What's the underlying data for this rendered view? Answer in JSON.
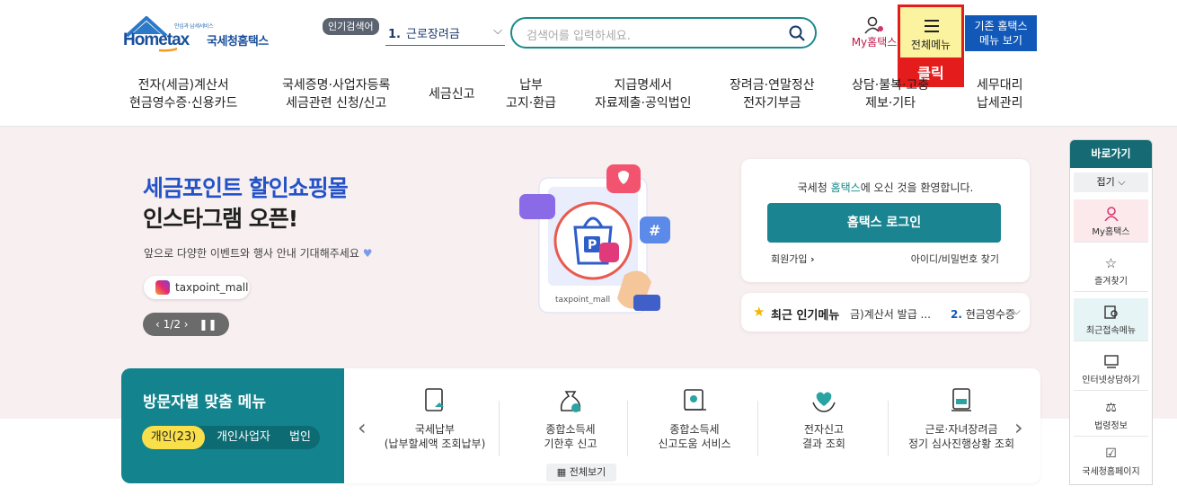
{
  "header": {
    "logo_small": "안심과 납세서비스",
    "logo_text": "Hometax",
    "logo_korean": "국세청홈택스",
    "popular_badge": "인기검색어",
    "popular_num": "1.",
    "popular_term": "근로장려금",
    "search_placeholder": "검색어를 입력하세요.",
    "my_hometax": "My홈택스",
    "all_menu": "전체메뉴",
    "click_callout": "클릭",
    "old_hometax_1": "기존 홈택스",
    "old_hometax_2": "메뉴 보기"
  },
  "nav": [
    {
      "l1": "전자(세금)계산서",
      "l2": "현금영수증·신용카드"
    },
    {
      "l1": "국세증명·사업자등록",
      "l2": "세금관련 신청/신고"
    },
    {
      "l1": "세금신고",
      "l2": ""
    },
    {
      "l1": "납부",
      "l2": "고지·환급"
    },
    {
      "l1": "지급명세서",
      "l2": "자료제출·공익법인"
    },
    {
      "l1": "장려금·연말정산",
      "l2": "전자기부금"
    },
    {
      "l1": "상담·불복·고충",
      "l2": "제보·기타"
    },
    {
      "l1": "세무대리",
      "l2": "납세관리"
    }
  ],
  "banner": {
    "title_line1": "세금포인트 할인쇼핑몰",
    "title_line2": "인스타그램 오픈!",
    "subtitle": "앞으로 다양한 이벤트와 행사 안내 기대해주세요",
    "chip": "taxpoint_mall",
    "pager": "1/2",
    "illus_label": "taxpoint_mall"
  },
  "login": {
    "welcome_pre": "국세청 ",
    "welcome_hl": "홈택스",
    "welcome_post": "에 오신 것을 환영합니다.",
    "login_button": "홈택스 로그인",
    "signup": "회원가입",
    "find": "아이디/비밀번호 찾기"
  },
  "popular_menu": {
    "title": "최근 인기메뉴",
    "item1": "금)계산서 발급 ...",
    "item2_num": "2.",
    "item2": "현금영수증"
  },
  "visitor": {
    "title": "방문자별 맞춤 메뉴",
    "tabs": [
      "개인(23)",
      "개인사업자",
      "법인"
    ]
  },
  "quick_menus": [
    {
      "l1": "국세납부",
      "l2": "(납부할세액 조회납부)"
    },
    {
      "l1": "종합소득세",
      "l2": "기한후 신고"
    },
    {
      "l1": "종합소득세",
      "l2": "신고도움 서비스"
    },
    {
      "l1": "전자신고",
      "l2": "결과 조회"
    },
    {
      "l1": "근로·자녀장려금",
      "l2": "정기 심사진행상황 조회"
    }
  ],
  "view_all": "전체보기",
  "quick_panel": {
    "title": "바로가기",
    "fold": "접기",
    "items": [
      "My홈택스",
      "즐겨찾기",
      "최근접속메뉴",
      "인터넷상담하기",
      "법령정보",
      "국세청홈페이지"
    ]
  }
}
